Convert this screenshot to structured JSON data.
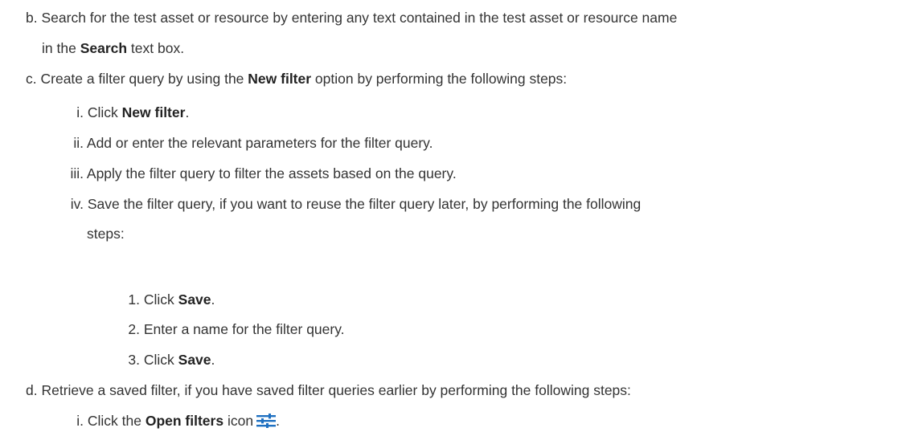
{
  "step_b": {
    "marker": "b.",
    "text_1": "Search for the test asset or resource by entering any text contained in the test asset or resource name",
    "text_2a": "in the ",
    "bold": "Search",
    "text_2b": " text box."
  },
  "step_c": {
    "marker": "c.",
    "text_a": "Create a filter query by using the ",
    "bold": "New filter",
    "text_b": " option by performing the following steps:",
    "substeps": [
      {
        "marker": "i.",
        "text_a": "Click ",
        "bold": "New filter",
        "text_b": "."
      },
      {
        "marker": "ii.",
        "text": "Add or enter the relevant parameters for the filter query."
      },
      {
        "marker": "iii.",
        "text": "Apply the filter query to filter the assets based on the query."
      },
      {
        "marker": "iv.",
        "text_1": "Save the filter query, if you want to reuse the filter query later, by performing the following",
        "text_2": "steps:"
      }
    ],
    "save_steps": [
      {
        "marker": "1.",
        "text_a": "Click ",
        "bold": "Save",
        "text_b": "."
      },
      {
        "marker": "2.",
        "text": "Enter a name for the filter query."
      },
      {
        "marker": "3.",
        "text_a": "Click ",
        "bold": "Save",
        "text_b": "."
      }
    ]
  },
  "step_d": {
    "marker": "d.",
    "text": "Retrieve a saved filter, if you have saved filter queries earlier by performing the following steps:",
    "substep_i": {
      "marker": "i.",
      "text_a": "Click the ",
      "bold": "Open filters",
      "text_b": " icon",
      "text_c": ".",
      "icon": "filter-sliders-icon",
      "icon_color": "#1f70c1"
    }
  }
}
